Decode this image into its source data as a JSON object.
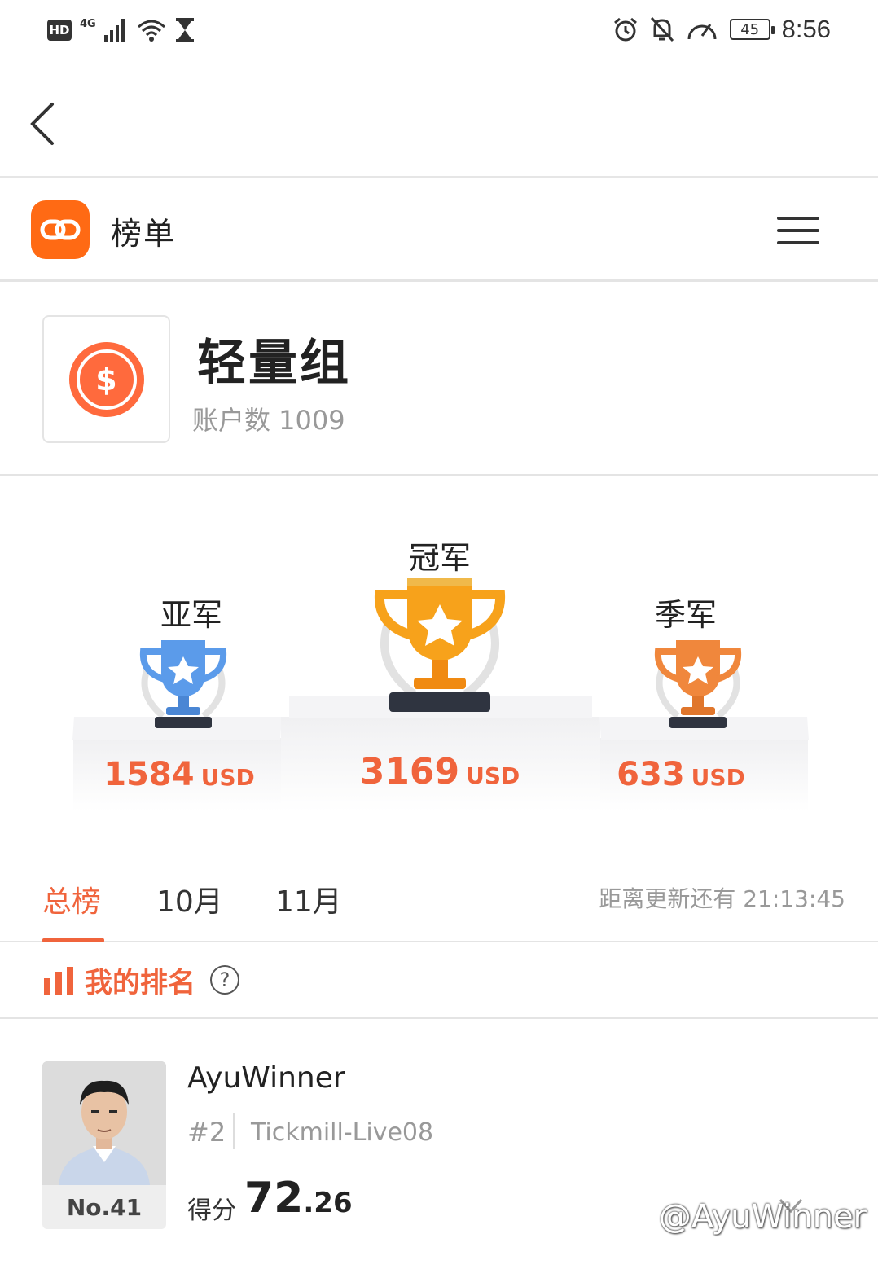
{
  "status_bar": {
    "hd": "HD",
    "network": "4G",
    "battery": "45",
    "time": "8:56"
  },
  "header": {
    "title": "榜单"
  },
  "group": {
    "title": "轻量组",
    "accounts_label": "账户数 1009",
    "coin_symbol": "$"
  },
  "podium": {
    "second": {
      "label": "亚军",
      "amount": "1584",
      "currency": "USD",
      "color": "#5b9bea"
    },
    "first": {
      "label": "冠军",
      "amount": "3169",
      "currency": "USD",
      "color": "#f7a21b"
    },
    "third": {
      "label": "季军",
      "amount": "633",
      "currency": "USD",
      "color": "#f0873c"
    }
  },
  "tabs": {
    "items": [
      "总榜",
      "10月",
      "11月"
    ],
    "active": "总榜",
    "countdown": "距离更新还有 21:13:45"
  },
  "my_rank": {
    "title": "我的排名",
    "help": "?"
  },
  "user": {
    "rank_no": "No.41",
    "name": "AyuWinner",
    "position": "#2",
    "account": "Tickmill-Live08",
    "score_label": "得分",
    "score_int": "72",
    "score_dec": ".26"
  },
  "watermark": "@AyuWinner",
  "colors": {
    "accent": "#f0643c",
    "brand": "#ff6a14"
  }
}
